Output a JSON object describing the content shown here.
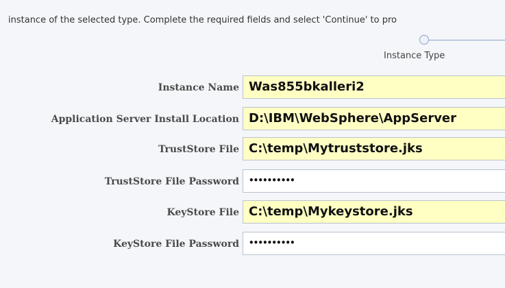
{
  "intro_text": "instance of the selected type. Complete the required fields and select 'Continue' to pro",
  "train": {
    "step_label": "Instance Type"
  },
  "fields": [
    {
      "label": "Instance Name",
      "value": "Was855bkalleri2"
    },
    {
      "label": "Application Server Install Location",
      "value": "D:\\IBM\\WebSphere\\AppServer"
    },
    {
      "label": "TrustStore File",
      "value": "C:\\temp\\Mytruststore.jks"
    },
    {
      "label": "TrustStore File Password",
      "value": "••••••••••"
    },
    {
      "label": "KeyStore File",
      "value": "C:\\temp\\Mykeystore.jks"
    },
    {
      "label": "KeyStore File Password",
      "value": "••••••••••"
    }
  ],
  "colors": {
    "required_field": "#ffffc4",
    "optional_field": "#ffffff",
    "background": "#f4f6f9"
  }
}
